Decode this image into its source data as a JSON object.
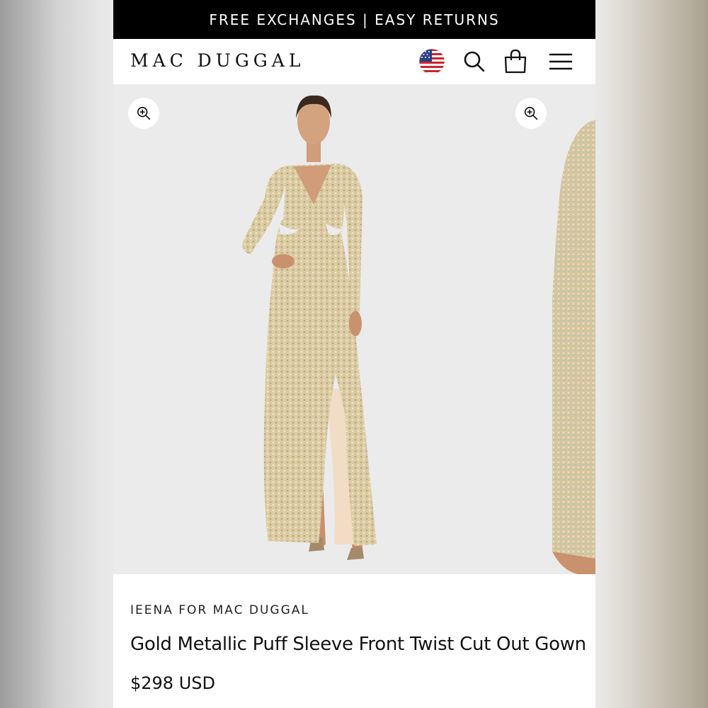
{
  "promo": {
    "text": "FREE EXCHANGES | EASY RETURNS"
  },
  "header": {
    "logo": "MAC DUGGAL",
    "icons": [
      "us-flag-icon",
      "search-icon",
      "shopping-bag-icon",
      "menu-icon"
    ]
  },
  "gallery": {
    "zoom_icon": "zoom-in-icon",
    "slides": [
      "model-front-photo",
      "sleeve-detail-photo"
    ]
  },
  "product": {
    "brand": "IEENA FOR MAC DUGGAL",
    "title": "Gold Metallic Puff Sleeve Front Twist Cut Out Gown",
    "price": "$298 USD"
  },
  "colors": {
    "promo_bg": "#000000",
    "page_bg": "#ffffff",
    "gallery_bg": "#ebebeb",
    "dress_gold": "#d9c79b"
  }
}
